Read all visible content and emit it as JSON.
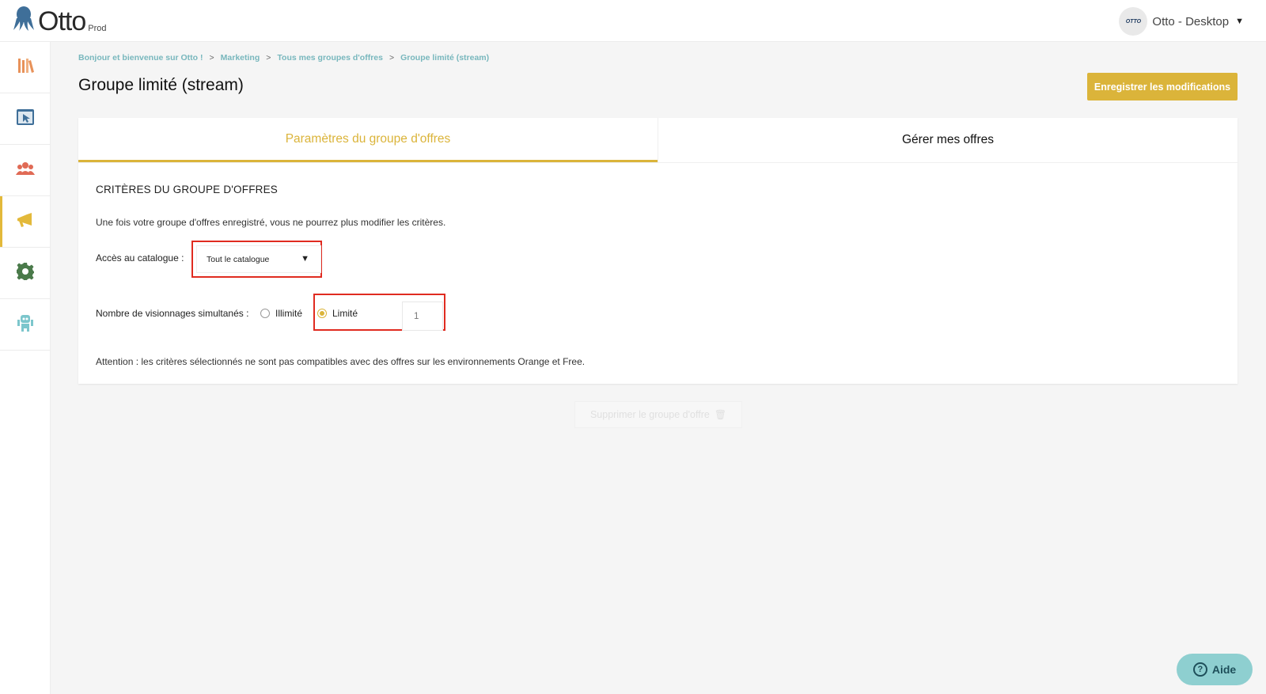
{
  "topbar": {
    "logo_text": "Otto",
    "logo_env": "Prod",
    "avatar_text": "OTTO",
    "account_name": "Otto - Desktop"
  },
  "sidebar": {
    "items": [
      {
        "icon": "library-icon",
        "color": "#e8925a"
      },
      {
        "icon": "content-cursor-icon",
        "color": "#3f6f99"
      },
      {
        "icon": "users-icon",
        "color": "#e06a55"
      },
      {
        "icon": "megaphone-icon",
        "color": "#e3b93a",
        "active": true
      },
      {
        "icon": "gear-icon",
        "color": "#4a7a4a"
      },
      {
        "icon": "robot-icon",
        "color": "#7cc6cc"
      }
    ]
  },
  "breadcrumb": [
    "Bonjour et bienvenue sur Otto !",
    "Marketing",
    "Tous mes groupes d'offres",
    "Groupe limité (stream)"
  ],
  "page": {
    "title": "Groupe limité (stream)",
    "save_label": "Enregistrer les modifications"
  },
  "tabs": [
    {
      "label": "Paramètres du groupe d'offres",
      "active": true
    },
    {
      "label": "Gérer mes offres",
      "active": false
    }
  ],
  "criteria": {
    "section_title": "CRITÈRES DU GROUPE D'OFFRES",
    "notice": "Une fois votre groupe d'offres enregistré, vous ne pourrez plus modifier les critères.",
    "catalog_label": "Accès au catalogue :",
    "catalog_value": "Tout le catalogue",
    "views_label": "Nombre de visionnages simultanés :",
    "radio_unlimited": "Illimité",
    "radio_limited": "Limité",
    "selected": "Limité",
    "limit_value": "1",
    "warning": "Attention : les critères sélectionnés ne sont pas compatibles avec des offres sur les environnements Orange et Free."
  },
  "delete_label": "Supprimer le groupe d'offre",
  "help_label": "Aide",
  "colors": {
    "accent": "#dbb43a",
    "link": "#78b7bd",
    "highlight": "#e02b20",
    "help": "#8ecfd0"
  }
}
